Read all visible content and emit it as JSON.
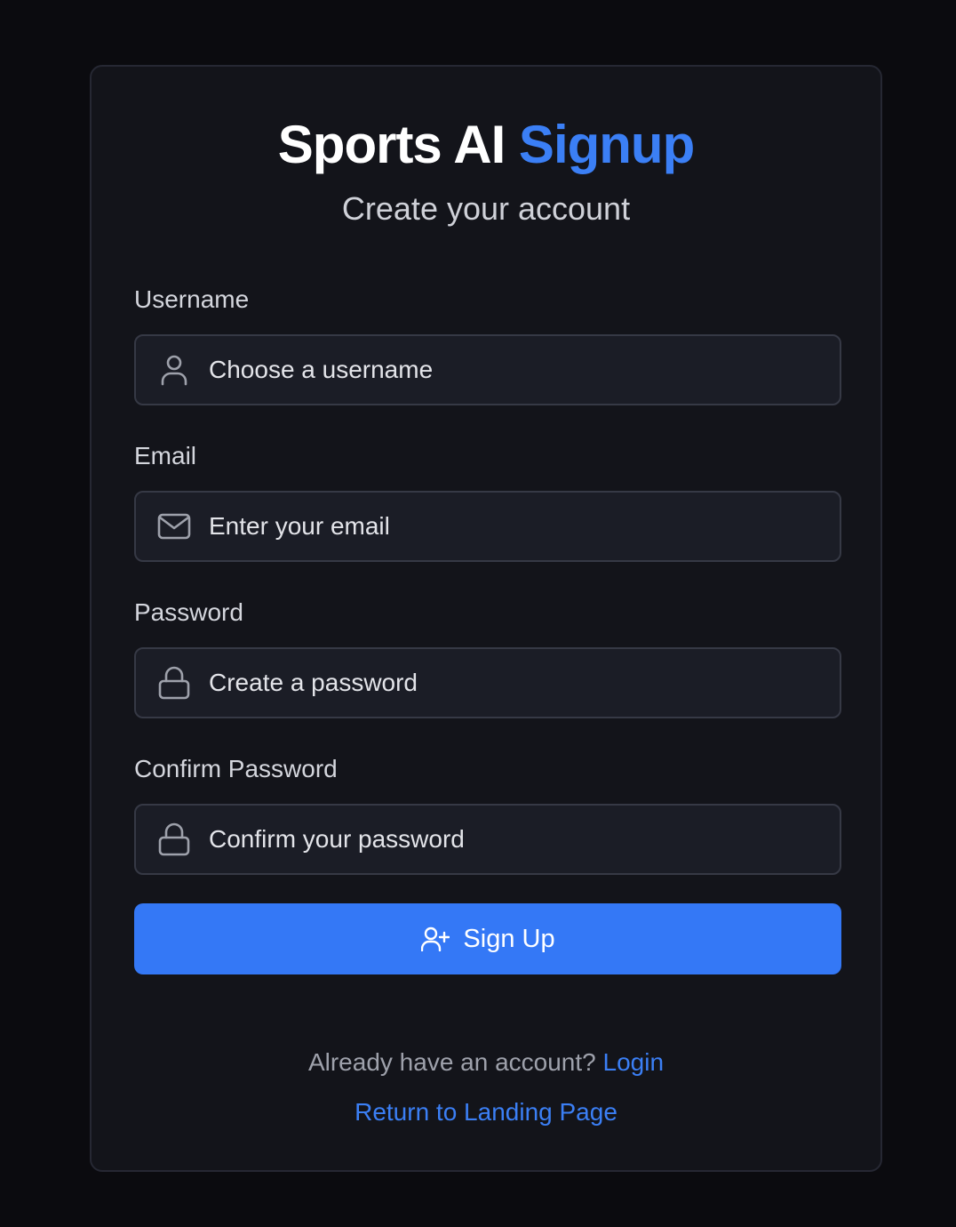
{
  "header": {
    "title_main": "Sports AI",
    "title_accent": "Signup",
    "subtitle": "Create your account"
  },
  "form": {
    "username": {
      "label": "Username",
      "placeholder": "Choose a username",
      "value": ""
    },
    "email": {
      "label": "Email",
      "placeholder": "Enter your email",
      "value": ""
    },
    "password": {
      "label": "Password",
      "placeholder": "Create a password",
      "value": ""
    },
    "confirm_password": {
      "label": "Confirm Password",
      "placeholder": "Confirm your password",
      "value": ""
    },
    "submit_label": "Sign Up"
  },
  "footer": {
    "login_prompt": "Already have an account?",
    "login_link": "Login",
    "landing_link": "Return to Landing Page"
  },
  "icons": {
    "username": "user-icon",
    "email": "mail-icon",
    "password": "lock-icon",
    "confirm_password": "lock-icon",
    "submit": "user-plus-icon"
  },
  "colors": {
    "background": "#0b0b0f",
    "card": "#13141a",
    "accent": "#3478f6",
    "link": "#3b7ff5"
  }
}
